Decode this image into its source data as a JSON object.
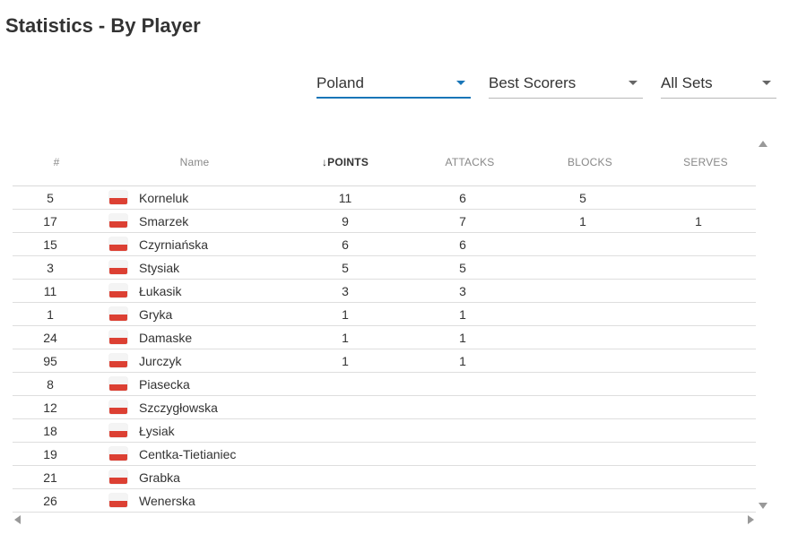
{
  "page_title": "Statistics - By Player",
  "filters": {
    "team": "Poland",
    "category": "Best Scorers",
    "sets": "All Sets"
  },
  "columns": {
    "number": "#",
    "name": "Name",
    "points": "↓POINTS",
    "attacks": "ATTACKS",
    "blocks": "BLOCKS",
    "serves": "SERVES"
  },
  "flag_colors": {
    "white": "#f4f4f4",
    "red": "#dc4033"
  },
  "rows": [
    {
      "num": "5",
      "name": "Korneluk",
      "points": "11",
      "attacks": "6",
      "blocks": "5",
      "serves": ""
    },
    {
      "num": "17",
      "name": "Smarzek",
      "points": "9",
      "attacks": "7",
      "blocks": "1",
      "serves": "1"
    },
    {
      "num": "15",
      "name": "Czyrniańska",
      "points": "6",
      "attacks": "6",
      "blocks": "",
      "serves": ""
    },
    {
      "num": "3",
      "name": "Stysiak",
      "points": "5",
      "attacks": "5",
      "blocks": "",
      "serves": ""
    },
    {
      "num": "11",
      "name": "Łukasik",
      "points": "3",
      "attacks": "3",
      "blocks": "",
      "serves": ""
    },
    {
      "num": "1",
      "name": "Gryka",
      "points": "1",
      "attacks": "1",
      "blocks": "",
      "serves": ""
    },
    {
      "num": "24",
      "name": "Damaske",
      "points": "1",
      "attacks": "1",
      "blocks": "",
      "serves": ""
    },
    {
      "num": "95",
      "name": "Jurczyk",
      "points": "1",
      "attacks": "1",
      "blocks": "",
      "serves": ""
    },
    {
      "num": "8",
      "name": "Piasecka",
      "points": "",
      "attacks": "",
      "blocks": "",
      "serves": ""
    },
    {
      "num": "12",
      "name": "Szczygłowska",
      "points": "",
      "attacks": "",
      "blocks": "",
      "serves": ""
    },
    {
      "num": "18",
      "name": "Łysiak",
      "points": "",
      "attacks": "",
      "blocks": "",
      "serves": ""
    },
    {
      "num": "19",
      "name": "Centka-Tietianiec",
      "points": "",
      "attacks": "",
      "blocks": "",
      "serves": ""
    },
    {
      "num": "21",
      "name": "Grabka",
      "points": "",
      "attacks": "",
      "blocks": "",
      "serves": ""
    },
    {
      "num": "26",
      "name": "Wenerska",
      "points": "",
      "attacks": "",
      "blocks": "",
      "serves": ""
    }
  ]
}
